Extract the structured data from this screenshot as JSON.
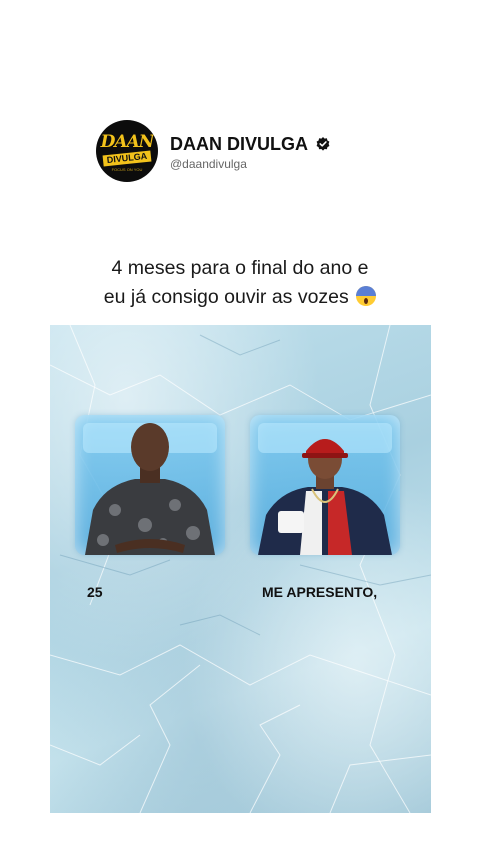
{
  "header": {
    "avatar_line1": "DAAN",
    "avatar_line2": "DIVULGA",
    "avatar_line3": "FOCUS ON YOU",
    "name": "DAAN DIVULGA",
    "handle": "@daandivulga",
    "verified_icon": "verified-badge-icon"
  },
  "post": {
    "caption_line1": "4 meses para o final do ano e",
    "caption_line2": "eu já consigo ouvir as vozes",
    "emoji": "screaming-face-emoji"
  },
  "image": {
    "left_label": "25",
    "right_label": "ME APRESENTO,"
  },
  "colors": {
    "ice": "#b5d8e6",
    "cube": "#4fb0e6",
    "badge_yellow": "#f2c21b"
  }
}
